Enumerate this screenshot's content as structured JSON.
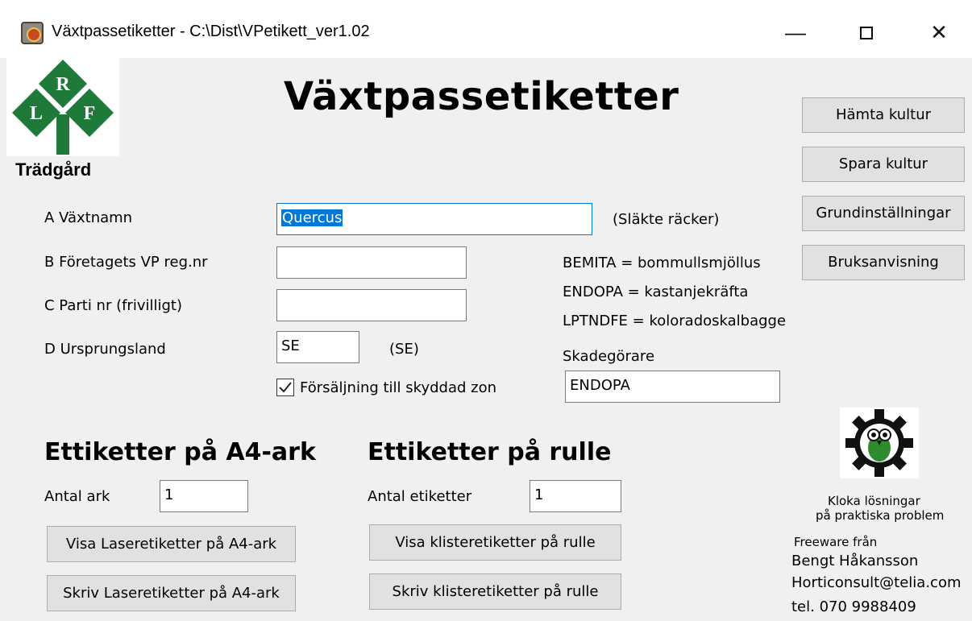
{
  "window": {
    "title": "Växtpassetiketter - C:\\Dist\\VPetikett_ver1.02",
    "minimize": "—",
    "close": "✕"
  },
  "logo": {
    "letters": [
      "R",
      "L",
      "F"
    ],
    "caption": "Trädgård",
    "color": "#1f7a3a"
  },
  "heading": "Växtpassetiketter",
  "side_buttons": {
    "hamta": "Hämta  kultur",
    "spara": "Spara  kultur",
    "grund": "Grundinställningar",
    "bruks": "Bruksanvisning"
  },
  "form": {
    "a_label": "A  Växtnamn",
    "a_value": "Quercus",
    "a_hint": "(Släkte räcker)",
    "b_label": "B  Företagets VP reg.nr",
    "b_value": "",
    "c_label": "C  Parti nr (frivilligt)",
    "c_value": "",
    "d_label": "D  Ursprungsland",
    "d_value": "SE",
    "d_hint": "(SE)",
    "zone_checked": true,
    "zone_label": "Försäljning till skyddad zon"
  },
  "pests": {
    "lines": [
      "BEMITA = bommullsmjöllus",
      "ENDOPA = kastanjekräfta",
      "LPTNDFE = koloradoskalbagge"
    ],
    "label": "Skadegörare",
    "value": "ENDOPA"
  },
  "a4": {
    "heading": "Ettiketter på A4-ark",
    "count_label": "Antal ark",
    "count_value": "1",
    "show_button": "Visa Laseretiketter på A4-ark",
    "print_button": "Skriv Laseretiketter på A4-ark"
  },
  "roll": {
    "heading": "Ettiketter på rulle",
    "count_label": "Antal etiketter",
    "count_value": "1",
    "show_button": "Visa klisteretiketter på rulle",
    "print_button": "Skriv klisteretiketter på rulle"
  },
  "credits": {
    "slogan1": "Kloka lösningar",
    "slogan2": "på praktiska problem",
    "freeware": "Freeware från",
    "name": "Bengt Håkansson",
    "email": "Horticonsult@telia.com",
    "phone": "tel. 070 9988409"
  }
}
